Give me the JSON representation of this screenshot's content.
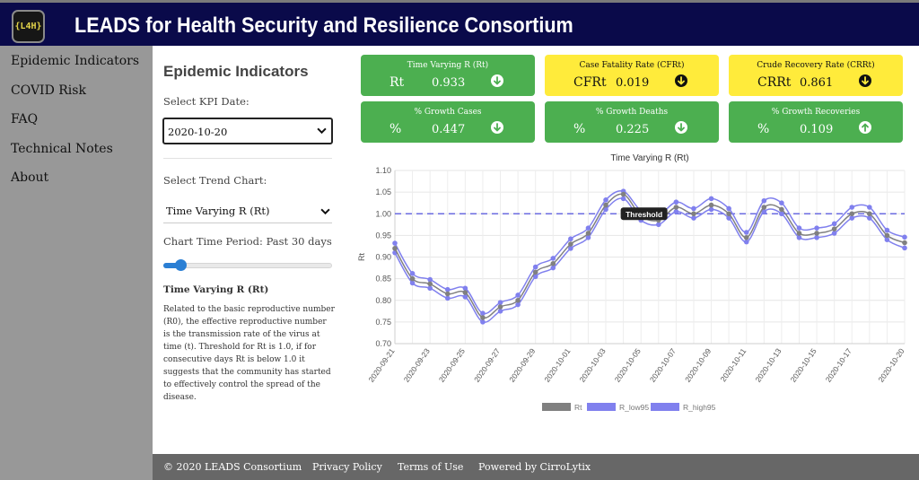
{
  "header": {
    "logo_text": "{L4H}",
    "title": "LEADS for Health Security and Resilience Consortium"
  },
  "sidebar": {
    "items": [
      {
        "label": "Epidemic Indicators"
      },
      {
        "label": "COVID Risk"
      },
      {
        "label": "FAQ"
      },
      {
        "label": "Technical Notes"
      },
      {
        "label": "About"
      }
    ]
  },
  "panel": {
    "title": "Epidemic Indicators",
    "kpi_date_label": "Select KPI Date:",
    "kpi_date_value": "2020-10-20",
    "trend_label": "Select Trend Chart:",
    "trend_value": "Time Varying R (Rt)",
    "period_label": "Chart Time Period: Past 30 days",
    "slider_value_fraction": 0.1,
    "desc_title": "Time Varying R (Rt)",
    "desc_text": "Related to the basic reproductive number (R0), the effective reproductive number is the transmission rate of the virus at time (t). Threshold for Rt is 1.0, if for consecutive days Rt is below 1.0 it suggests that the community has started to effectively control the spread of the disease."
  },
  "kpis": [
    {
      "label": "Time Varying R (Rt)",
      "symbol": "Rt",
      "value": "0.933",
      "color": "green",
      "trend": "down"
    },
    {
      "label": "Case Fatality Rate (CFRt)",
      "symbol": "CFRt",
      "value": "0.019",
      "color": "yellow",
      "trend": "down"
    },
    {
      "label": "Crude Recovery Rate (CRRt)",
      "symbol": "CRRt",
      "value": "0.861",
      "color": "yellow",
      "trend": "down"
    },
    {
      "label": "% Growth Cases",
      "symbol": "%",
      "value": "0.447",
      "color": "green",
      "trend": "down"
    },
    {
      "label": "% Growth Deaths",
      "symbol": "%",
      "value": "0.225",
      "color": "green",
      "trend": "down"
    },
    {
      "label": "% Growth Recoveries",
      "symbol": "%",
      "value": "0.109",
      "color": "green",
      "trend": "up"
    }
  ],
  "colors": {
    "green": "#4caf50",
    "yellow": "#ffeb3b",
    "header": "#0a0a4a",
    "sidebar": "#989898",
    "footer": "#676767",
    "rt": "#808080",
    "bounds": "#8080ee",
    "threshold": "#6b6be0"
  },
  "chart_data": {
    "type": "line",
    "title": "Time Varying R (Rt)",
    "ylabel": "Rt",
    "xlabel": "",
    "ylim": [
      0.7,
      1.1
    ],
    "yticks": [
      "0.70",
      "0.75",
      "0.80",
      "0.85",
      "0.90",
      "0.95",
      "1.00",
      "1.05",
      "1.10"
    ],
    "x": [
      "2020-09-21",
      "2020-09-22",
      "2020-09-23",
      "2020-09-24",
      "2020-09-25",
      "2020-09-26",
      "2020-09-27",
      "2020-09-28",
      "2020-09-29",
      "2020-09-30",
      "2020-10-01",
      "2020-10-02",
      "2020-10-03",
      "2020-10-04",
      "2020-10-05",
      "2020-10-06",
      "2020-10-07",
      "2020-10-08",
      "2020-10-09",
      "2020-10-10",
      "2020-10-11",
      "2020-10-12",
      "2020-10-13",
      "2020-10-14",
      "2020-10-15",
      "2020-10-16",
      "2020-10-17",
      "2020-10-18",
      "2020-10-19",
      "2020-10-20"
    ],
    "xtick_labels": [
      "2020-09-21",
      "2020-09-23",
      "2020-09-25",
      "2020-09-27",
      "2020-09-29",
      "2020-10-01",
      "2020-10-03",
      "2020-10-05",
      "2020-10-07",
      "2020-10-09",
      "2020-10-11",
      "2020-10-13",
      "2020-10-15",
      "2020-10-17",
      "2020-10-20"
    ],
    "series": [
      {
        "name": "Rt",
        "color": "#808080",
        "values": [
          0.92,
          0.85,
          0.838,
          0.815,
          0.818,
          0.76,
          0.785,
          0.8,
          0.865,
          0.885,
          0.93,
          0.955,
          1.02,
          1.045,
          0.995,
          0.985,
          1.015,
          1.0,
          1.02,
          1.0,
          0.945,
          1.015,
          1.01,
          0.955,
          0.955,
          0.965,
          1.0,
          1.0,
          0.95,
          0.933
        ]
      },
      {
        "name": "R_low95",
        "color": "#8080ee",
        "values": [
          0.91,
          0.84,
          0.828,
          0.805,
          0.808,
          0.75,
          0.775,
          0.79,
          0.855,
          0.875,
          0.92,
          0.945,
          1.01,
          1.035,
          0.985,
          0.975,
          1.005,
          0.99,
          1.01,
          0.99,
          0.935,
          1.005,
          1.0,
          0.945,
          0.945,
          0.955,
          0.99,
          0.99,
          0.94,
          0.921
        ]
      },
      {
        "name": "R_high95",
        "color": "#8080ee",
        "values": [
          0.932,
          0.862,
          0.848,
          0.825,
          0.828,
          0.77,
          0.795,
          0.812,
          0.877,
          0.897,
          0.942,
          0.967,
          1.032,
          1.052,
          1.007,
          0.997,
          1.027,
          1.012,
          1.035,
          1.012,
          0.957,
          1.03,
          1.025,
          0.967,
          0.967,
          0.977,
          1.015,
          1.015,
          0.962,
          0.946
        ]
      }
    ],
    "threshold": {
      "value": 1.0,
      "label": "Threshold"
    },
    "grid": true,
    "legend": "bottom"
  },
  "footer": {
    "copyright": "© 2020 LEADS Consortium",
    "privacy": "Privacy Policy",
    "terms": "Terms of Use",
    "powered": "Powered by CirroLytix"
  }
}
